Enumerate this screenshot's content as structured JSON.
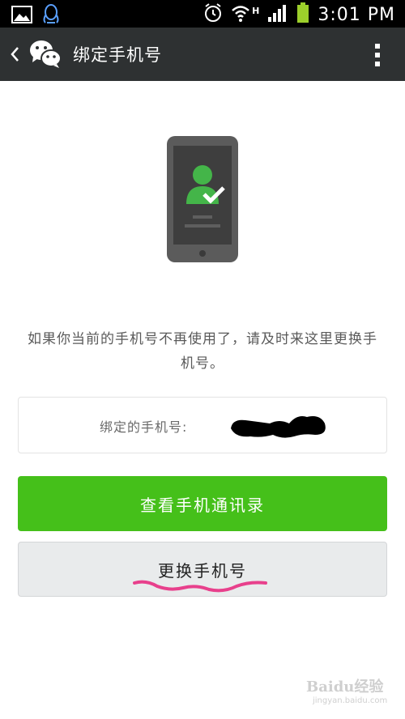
{
  "status_bar": {
    "time": "3:01 PM",
    "network_type": "H",
    "icons": [
      "gallery-icon",
      "qq-icon",
      "alarm-icon",
      "wifi-icon",
      "signal-icon",
      "battery-icon"
    ]
  },
  "action_bar": {
    "title": "绑定手机号",
    "icons": [
      "back-chevron-icon",
      "wechat-logo-icon",
      "more-vertical-icon"
    ]
  },
  "hint": {
    "text": "如果你当前的手机号不再使用了，请及时来这里更换手机号。"
  },
  "bound_number": {
    "label": "绑定的手机号:"
  },
  "buttons": {
    "view_contacts": "查看手机通讯录",
    "change_number": "更换手机号"
  },
  "colors": {
    "status_bar_bg": "#000000",
    "action_bar_bg": "#2e3132",
    "primary_green": "#45c01a",
    "secondary_bg": "#e9ebec",
    "annotation_pink": "#e8408c"
  },
  "watermark": {
    "text": "Baidu经验",
    "sub": "jingyan.baidu.com"
  }
}
